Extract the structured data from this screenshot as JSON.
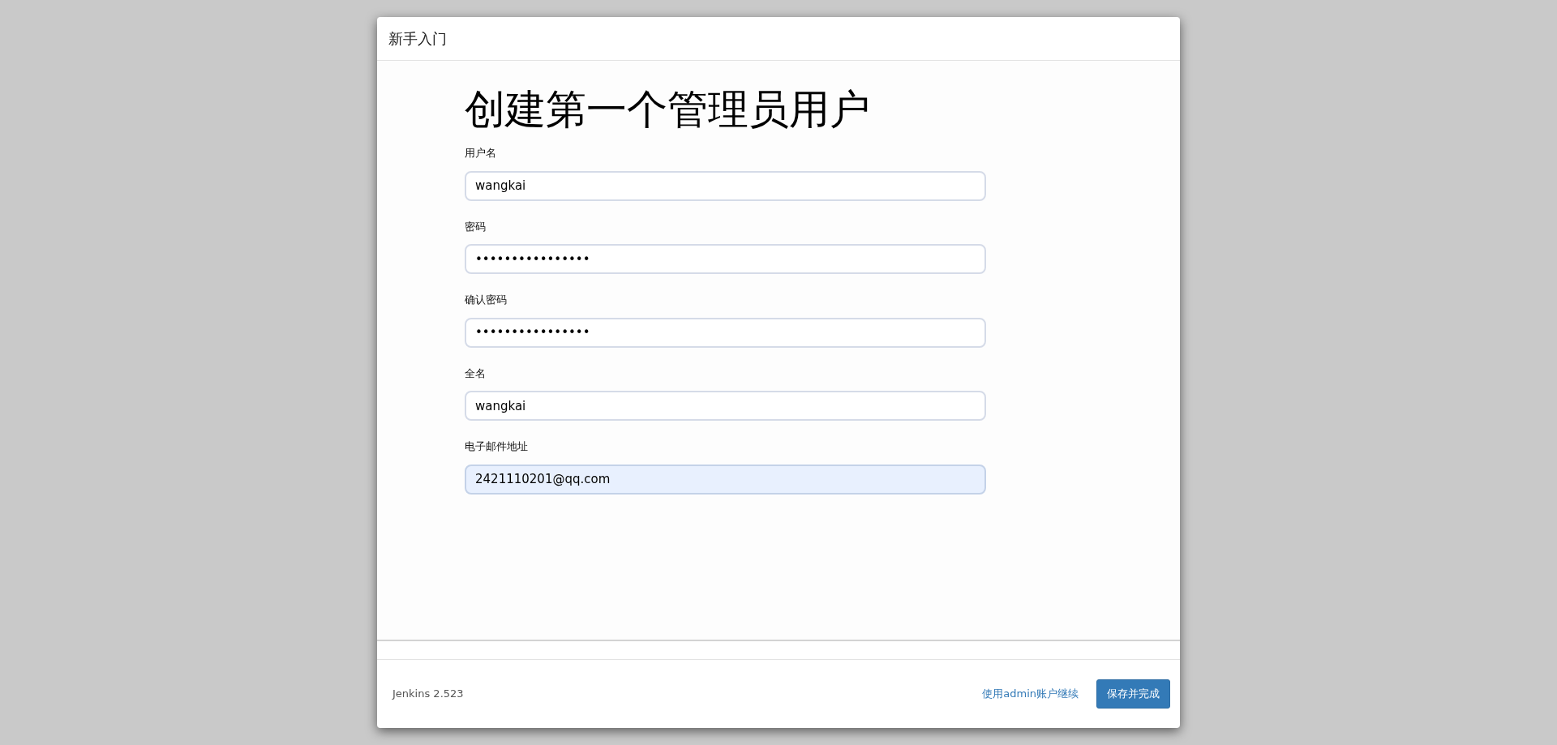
{
  "dialog": {
    "title": "新手入门"
  },
  "heading": "创建第一个管理员用户",
  "fields": [
    {
      "label": "用户名",
      "value": "wangkai",
      "autofilled": false
    },
    {
      "label": "密码",
      "value": "••••••••••••••••",
      "autofilled": false
    },
    {
      "label": "确认密码",
      "value": "••••••••••••••••",
      "autofilled": false
    },
    {
      "label": "全名",
      "value": "wangkai",
      "autofilled": false
    },
    {
      "label": "电子邮件地址",
      "value": "2421110201@qq.com",
      "autofilled": true
    }
  ],
  "footer": {
    "version": "Jenkins 2.523",
    "skip_link": "使用admin账户继续",
    "save_button": "保存并完成"
  }
}
